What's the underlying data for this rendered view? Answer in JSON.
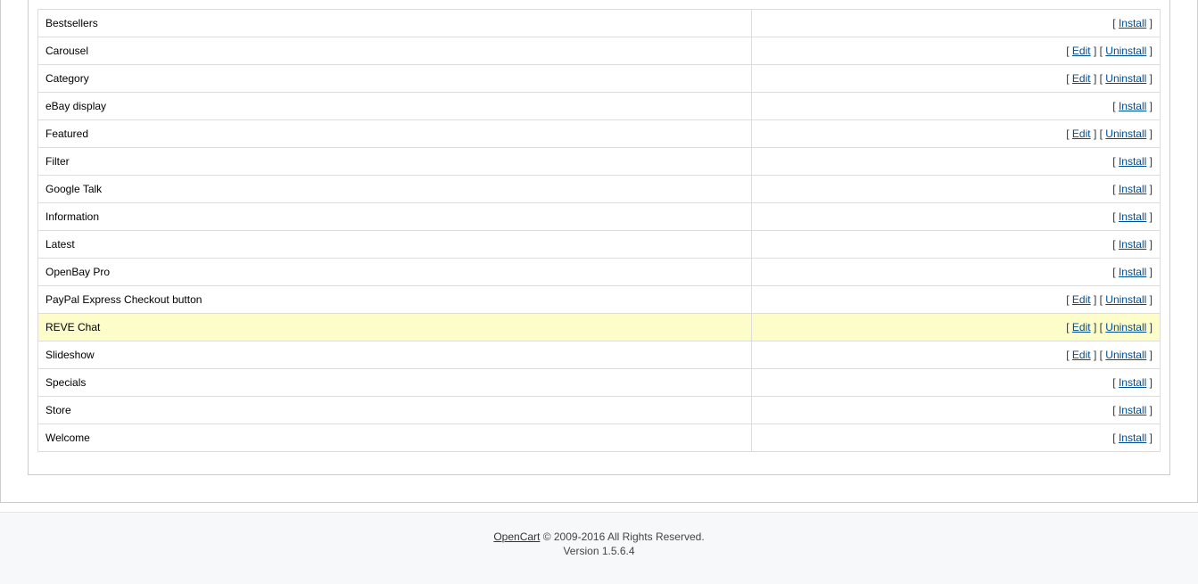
{
  "labels": {
    "install": "Install",
    "edit": "Edit",
    "uninstall": "Uninstall"
  },
  "modules": [
    {
      "name": "Bestsellers",
      "installed": false,
      "highlight": false
    },
    {
      "name": "Carousel",
      "installed": true,
      "highlight": false
    },
    {
      "name": "Category",
      "installed": true,
      "highlight": false
    },
    {
      "name": "eBay display",
      "installed": false,
      "highlight": false
    },
    {
      "name": "Featured",
      "installed": true,
      "highlight": false
    },
    {
      "name": "Filter",
      "installed": false,
      "highlight": false
    },
    {
      "name": "Google Talk",
      "installed": false,
      "highlight": false
    },
    {
      "name": "Information",
      "installed": false,
      "highlight": false
    },
    {
      "name": "Latest",
      "installed": false,
      "highlight": false
    },
    {
      "name": "OpenBay Pro",
      "installed": false,
      "highlight": false
    },
    {
      "name": "PayPal Express Checkout button",
      "installed": true,
      "highlight": false
    },
    {
      "name": "REVE Chat",
      "installed": true,
      "highlight": true
    },
    {
      "name": "Slideshow",
      "installed": true,
      "highlight": false
    },
    {
      "name": "Specials",
      "installed": false,
      "highlight": false
    },
    {
      "name": "Store",
      "installed": false,
      "highlight": false
    },
    {
      "name": "Welcome",
      "installed": false,
      "highlight": false
    }
  ],
  "footer": {
    "brand": "OpenCart",
    "copyright": " © 2009-2016 All Rights Reserved.",
    "version": "Version 1.5.6.4"
  }
}
